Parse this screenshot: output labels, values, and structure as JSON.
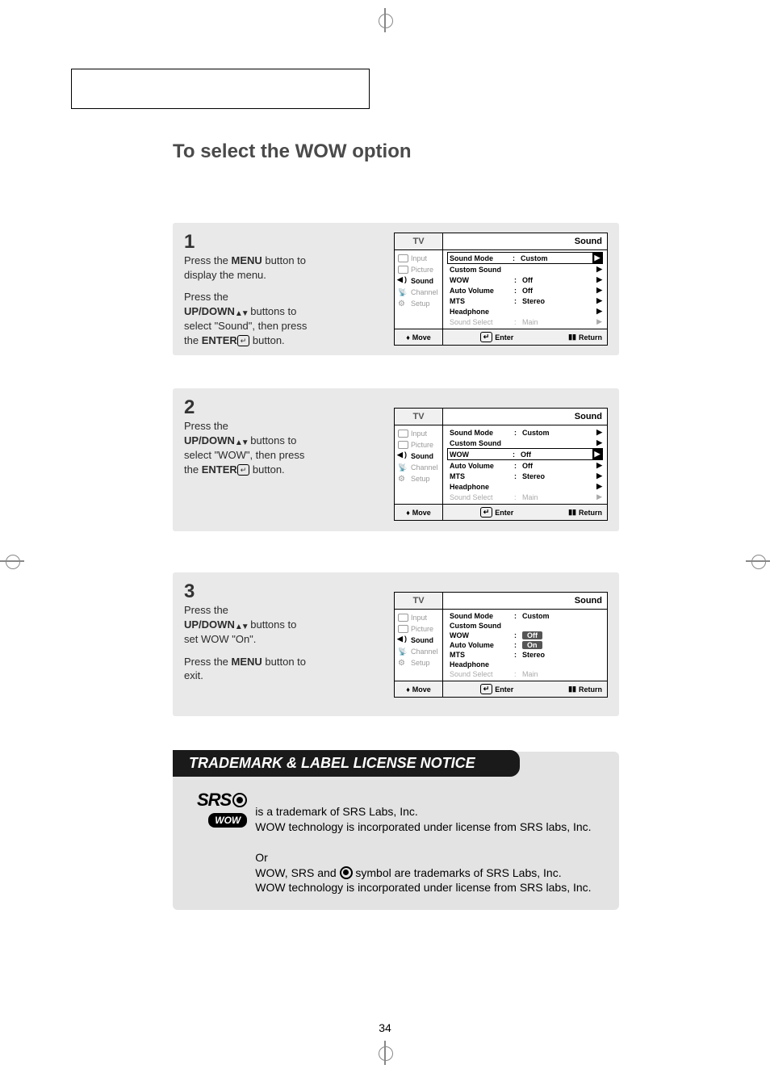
{
  "page_number": "34",
  "title": "To select the WOW option",
  "steps": {
    "s1": {
      "num": "1",
      "p1_a": "Press the ",
      "p1_menu": "MENU",
      "p1_b": " button to display the menu.",
      "p2_a": "Press the",
      "p2_updown": "UP/DOWN",
      "p2_b": " buttons to select \"Sound\", then press the ",
      "p2_enter": "ENTER",
      "p2_c": " button."
    },
    "s2": {
      "num": "2",
      "p1_a": "Press the",
      "p1_updown": "UP/DOWN",
      "p1_b": " buttons to select \"WOW\", then press the ",
      "p1_enter": "ENTER",
      "p1_c": " button."
    },
    "s3": {
      "num": "3",
      "p1_a": "Press the",
      "p1_updown": "UP/DOWN",
      "p1_b": " buttons to set WOW \"On\".",
      "p2_a": "Press the ",
      "p2_menu": "MENU",
      "p2_b": " button to exit."
    }
  },
  "osd": {
    "tv": "TV",
    "sound": "Sound",
    "side": {
      "input": "Input",
      "picture": "Picture",
      "sound": "Sound",
      "channel": "Channel",
      "setup": "Setup"
    },
    "rows": {
      "sound_mode": "Sound Mode",
      "custom_sound": "Custom Sound",
      "wow": "WOW",
      "auto_volume": "Auto Volume",
      "mts": "MTS",
      "headphone": "Headphone",
      "sound_select": "Sound Select"
    },
    "values": {
      "custom": "Custom",
      "off": "Off",
      "on": "On",
      "stereo": "Stereo",
      "main": "Main"
    },
    "foot": {
      "move": "Move",
      "enter": "Enter",
      "return": "Return"
    }
  },
  "notice": {
    "banner": "TRADEMARK & LABEL LICENSE NOTICE",
    "srs": "SRS",
    "wow": "WOW",
    "line1": " is a  trademark of SRS Labs, Inc.",
    "line2": "WOW technology is incorporated under license from SRS labs, Inc.",
    "or": "Or",
    "line3a": "WOW, SRS and ",
    "line3b": " symbol are trademarks of SRS Labs, Inc.",
    "line4": "WOW technology is incorporated under license from SRS labs, Inc."
  }
}
